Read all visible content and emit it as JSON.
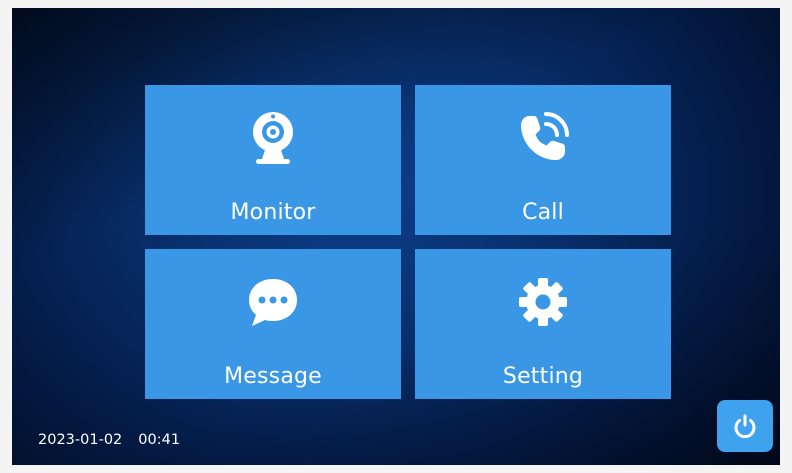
{
  "tiles": {
    "monitor": {
      "label": "Monitor",
      "icon": "webcam-icon"
    },
    "call": {
      "label": "Call",
      "icon": "phone-ringing-icon"
    },
    "message": {
      "label": "Message",
      "icon": "chat-bubble-icon"
    },
    "setting": {
      "label": "Setting",
      "icon": "gear-icon"
    }
  },
  "status": {
    "date": "2023-01-02",
    "time": "00:41"
  },
  "power": {
    "icon": "power-icon"
  },
  "colors": {
    "tile": "#3a97e6",
    "power_button": "#3fa2ee",
    "background": "#08306e",
    "text": "#ffffff"
  }
}
